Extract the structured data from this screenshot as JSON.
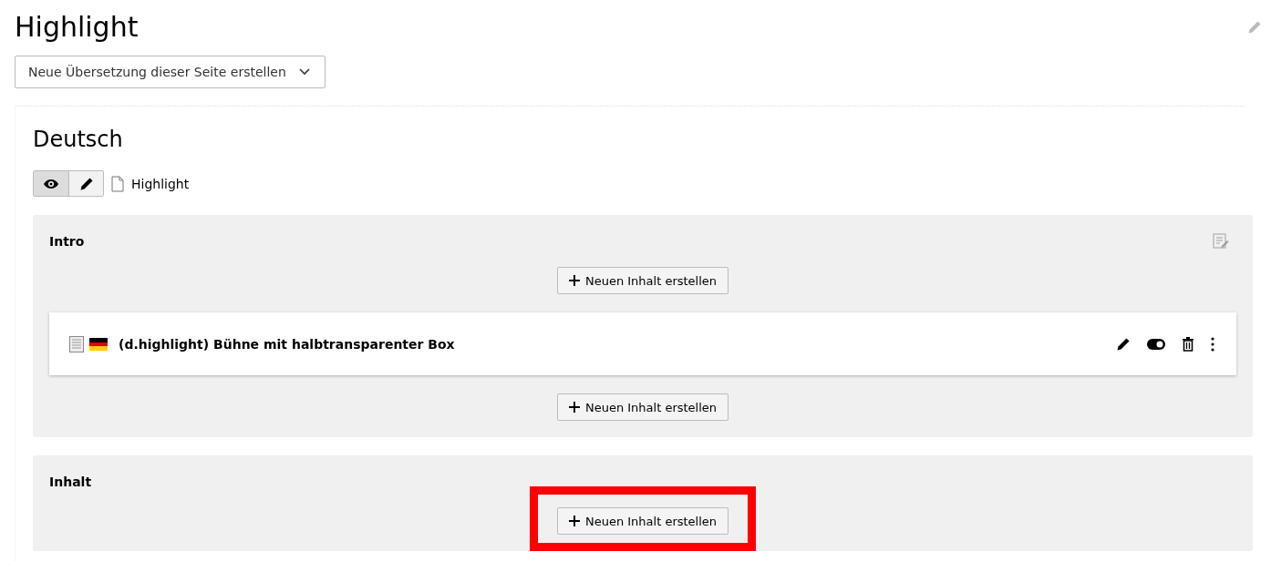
{
  "page_title": "Highlight",
  "translation_dropdown": {
    "label": "Neue Übersetzung dieser Seite erstellen"
  },
  "language": {
    "title": "Deutsch",
    "page_label": "Highlight",
    "view_modes": [
      {
        "kind": "preview",
        "selected": true
      },
      {
        "kind": "edit",
        "selected": false
      }
    ]
  },
  "columns": [
    {
      "title": "Intro",
      "editable": true,
      "items": [
        {
          "kind": "new_button",
          "label": "Neuen Inhalt erstellen"
        },
        {
          "kind": "content",
          "title": "(d.highlight) Bühne mit halbtransparenter Box"
        },
        {
          "kind": "new_button",
          "label": "Neuen Inhalt erstellen"
        }
      ]
    },
    {
      "title": "Inhalt",
      "editable": false,
      "items": [
        {
          "kind": "new_button",
          "label": "Neuen Inhalt erstellen",
          "highlighted": true
        }
      ]
    }
  ]
}
